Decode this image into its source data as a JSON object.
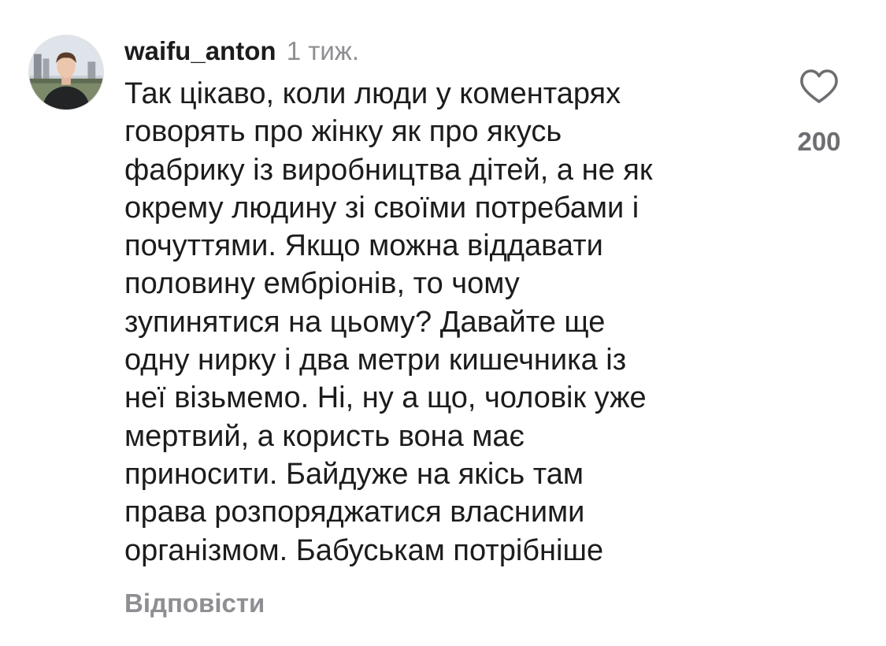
{
  "comment": {
    "username": "waifu_anton",
    "time": "1 тиж.",
    "avatar_icon": "user-avatar-photo",
    "text_lines": [
      "Так цікаво, коли люди у коментарях",
      "говорять про жінку як про якусь",
      "фабрику із виробництва дітей, а не як",
      "окрему людину зі своїми потребами і",
      "почуттями. Якщо можна віддавати",
      "половину ембріонів, то чому",
      "зупинятися на цьому? Давайте ще",
      "одну нирку і два метри кишечника із",
      "неї візьмемо. Ні, ну а що, чоловік уже",
      "мертвий, а користь вона має",
      "приносити. Байдуже на якісь там",
      "права розпоряджатися власними",
      "організмом. Бабуськам потрібніше"
    ],
    "reply_label": "Відповісти",
    "like_icon": "heart-outline-icon",
    "like_count": "200"
  },
  "colors": {
    "text": "#1c1c1e",
    "secondary": "#8e8e93",
    "like_count": "#6d6d72",
    "background": "#ffffff"
  }
}
